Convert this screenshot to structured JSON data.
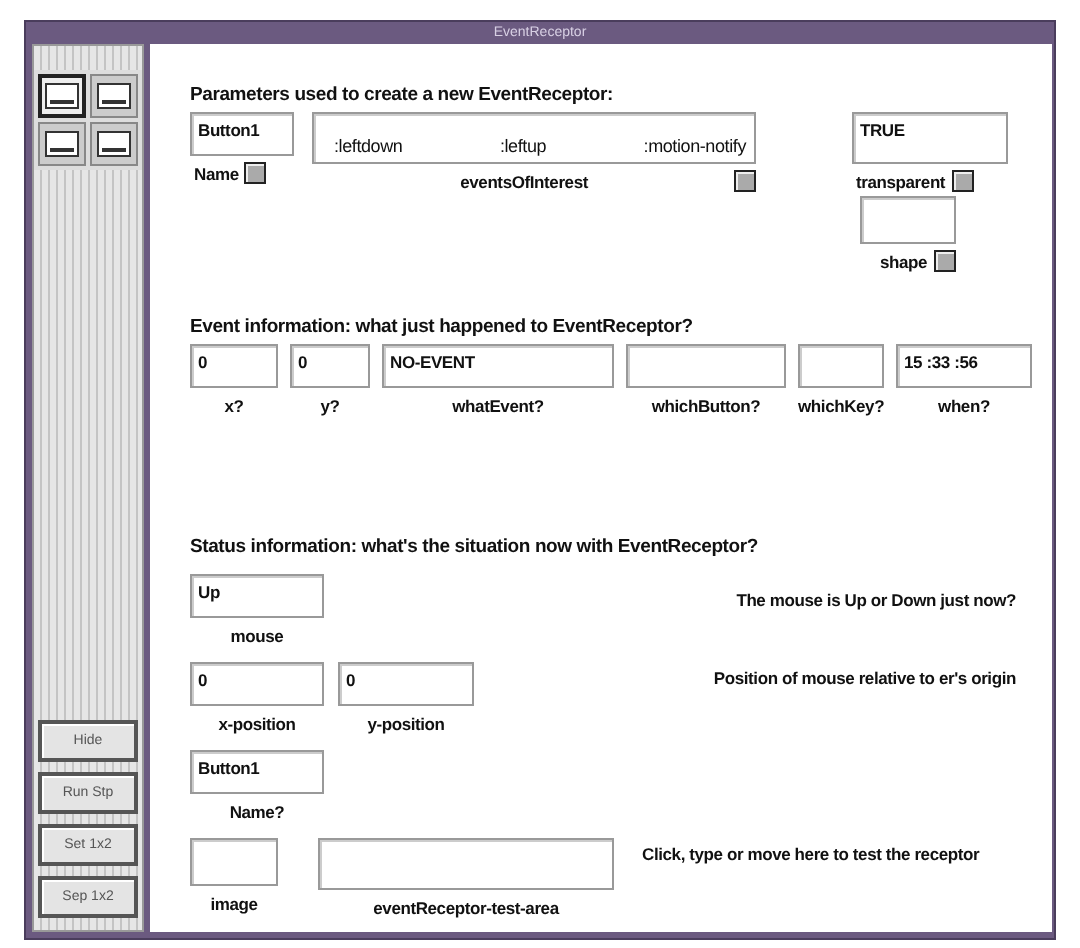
{
  "window": {
    "title": "EventReceptor"
  },
  "tools": [
    {
      "selected": true
    },
    {
      "selected": false
    },
    {
      "selected": false
    },
    {
      "selected": false
    }
  ],
  "side_buttons": [
    "Hide",
    "Run Stp",
    "Set 1x2",
    "Sep 1x2"
  ],
  "parameters": {
    "heading": "Parameters used to create a new EventReceptor:",
    "name": {
      "value": "Button1",
      "label": "Name"
    },
    "events": {
      "values": [
        ":leftdown",
        ":leftup",
        ":motion-notify"
      ],
      "label": "eventsOfInterest"
    },
    "transparent": {
      "value": "TRUE",
      "label": "transparent"
    },
    "shape": {
      "label": "shape"
    }
  },
  "event_info": {
    "heading": "Event information: what just happened to EventReceptor?",
    "fields": [
      {
        "value": "0",
        "label": "x?"
      },
      {
        "value": "0",
        "label": "y?"
      },
      {
        "value": "NO-EVENT",
        "label": "whatEvent?"
      },
      {
        "label": "whichButton?"
      },
      {
        "label": "whichKey?"
      },
      {
        "value": "15 :33 :56",
        "label": "when?"
      }
    ]
  },
  "status": {
    "heading": "Status information: what's the situation now with EventReceptor?",
    "mouse": {
      "value": "Up",
      "label": "mouse",
      "note": "The mouse is Up or Down just now?"
    },
    "x_position": {
      "value": "0",
      "label": "x-position"
    },
    "y_position": {
      "value": "0",
      "label": "y-position"
    },
    "position_note": "Position of mouse relative to er's origin",
    "name": {
      "value": "Button1",
      "label": "Name?"
    },
    "image": {
      "label": "image"
    },
    "test_area": {
      "label": "eventReceptor-test-area"
    },
    "test_note": "Click, type or move here to test the receptor"
  }
}
